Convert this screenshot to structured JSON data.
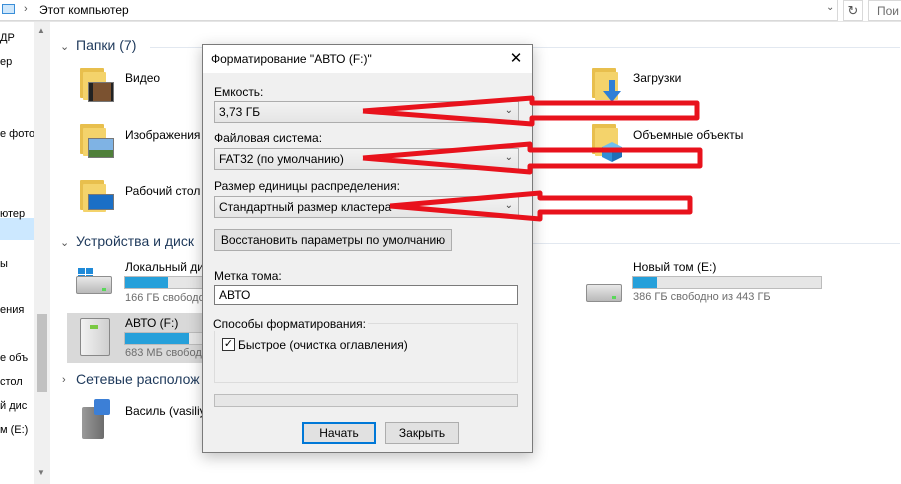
{
  "address_bar": {
    "separator": "›",
    "location": "Этот компьютер",
    "dropdown": "⌄",
    "refresh": "↻",
    "search_placeholder": "Пои"
  },
  "nav_pane": {
    "items": [
      "ДР",
      "ер",
      "е фото",
      "ютер",
      "ы",
      "ения",
      "е объ",
      "стол",
      "й дис",
      "м (E:)"
    ],
    "selected_index": 3
  },
  "groups": {
    "folders": {
      "chevron": "⌄",
      "title": "Папки (7)"
    },
    "devices": {
      "chevron": "⌄",
      "title": "Устройства и диск"
    },
    "network": {
      "chevron": "›",
      "title": "Сетевые располож"
    }
  },
  "folders": [
    {
      "label": "Видео",
      "icon": "video-folder-icon"
    },
    {
      "label": "Изображения",
      "icon": "pictures-folder-icon"
    },
    {
      "label": "Рабочий стол",
      "icon": "desktop-folder-icon"
    },
    {
      "label": "Загрузки",
      "icon": "downloads-folder-icon"
    },
    {
      "label": "Объемные объекты",
      "icon": "3d-objects-folder-icon"
    }
  ],
  "drives": [
    {
      "label": "Локальный ди",
      "sub": "166 ГБ свободо",
      "fill": 0.55
    },
    {
      "label": "АВТО (F:)",
      "sub": "683 МБ свободо",
      "fill": 0.82
    },
    {
      "label": "Новый том (E:)",
      "sub": "386 ГБ свободно из 443 ГБ",
      "fill": 0.13
    }
  ],
  "network_items": [
    {
      "label": "Василь (vasiliy"
    }
  ],
  "dialog": {
    "title": "Форматирование \"АВТО (F:)\"",
    "close_glyph": "✕",
    "capacity_label": "Емкость:",
    "capacity_value": "3,73 ГБ",
    "filesystem_label": "Файловая система:",
    "filesystem_value": "FAT32 (по умолчанию)",
    "cluster_label": "Размер единицы распределения:",
    "cluster_value": "Стандартный размер кластера",
    "restore_defaults": "Восстановить параметры по умолчанию",
    "volume_label_title": "Метка тома:",
    "volume_label_value": "АВТО",
    "format_options_title": "Способы форматирования:",
    "quick_format_label": "Быстрое (очистка оглавления)",
    "quick_format_checked": true,
    "check_glyph": "✓",
    "start_button": "Начать",
    "close_button": "Закрыть",
    "combo_arrow": "⌄",
    "progress": 0
  },
  "colors": {
    "accent": "#26a0da",
    "annotation": "#e8121c",
    "selection": "#cce8ff",
    "default_button_border": "#0078d7"
  }
}
